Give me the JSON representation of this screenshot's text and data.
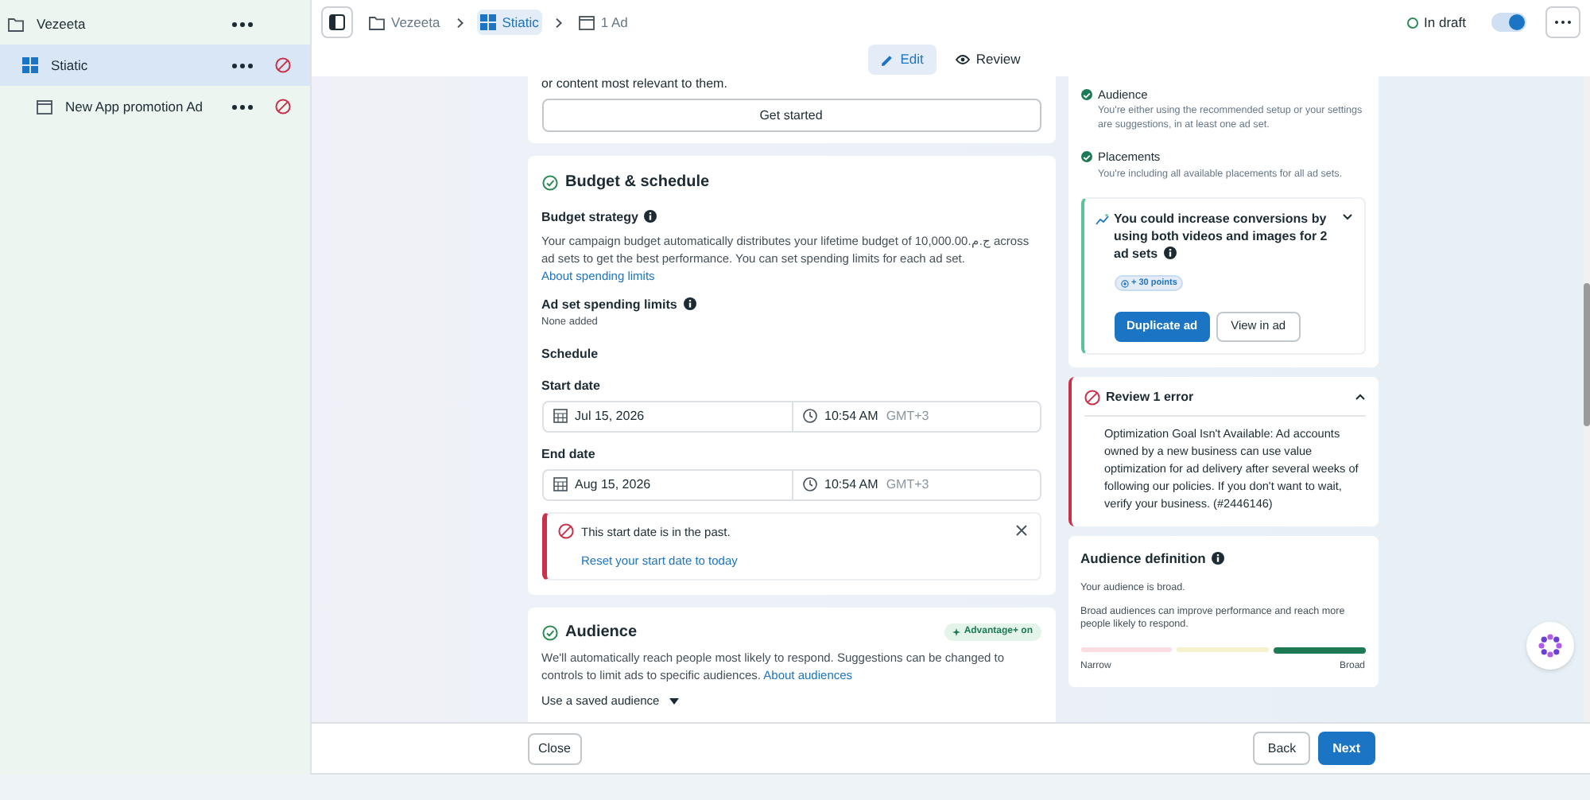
{
  "sidebar": {
    "items": [
      {
        "kind": "campaign",
        "label": "Vezeeta",
        "selected": false,
        "error": false,
        "children": [
          {
            "kind": "adset",
            "label": "Stiatic",
            "selected": true,
            "error": true,
            "children": [
              {
                "kind": "ad",
                "label": "New App promotion Ad",
                "selected": false,
                "error": true
              }
            ]
          }
        ]
      }
    ]
  },
  "breadcrumb": [
    {
      "kind": "campaign",
      "label": "Vezeeta",
      "selected": false
    },
    {
      "kind": "adset",
      "label": "Stiatic",
      "selected": true
    },
    {
      "kind": "ad",
      "label": "1 Ad",
      "selected": false
    }
  ],
  "status": {
    "label": "In draft",
    "toggle_on": true
  },
  "mode_tabs": [
    {
      "kind": "edit",
      "label": "Edit",
      "selected": true
    },
    {
      "kind": "review",
      "label": "Review",
      "selected": false
    }
  ],
  "top_card": {
    "text": "or content most relevant to them.",
    "button": "Get started"
  },
  "budget": {
    "title": "Budget & schedule",
    "strategy_label": "Budget strategy",
    "strategy_text": "Your campaign budget automatically distributes your lifetime budget of 10,000.00.ج.م across ad sets to get the best performance. You can set spending limits for each ad set.",
    "link": "About spending limits",
    "limits_label": "Ad set spending limits",
    "limits_value": "None added",
    "schedule_label": "Schedule",
    "dates": [
      {
        "label": "Start date",
        "date": "Jul 15, 2026",
        "time": "10:54 AM",
        "zone": "GMT+3"
      },
      {
        "label": "End date",
        "date": "Aug 15, 2026",
        "time": "10:54 AM",
        "zone": "GMT+3"
      }
    ],
    "alert": {
      "message": "This start date is in the past.",
      "link": "Reset your start date to today"
    }
  },
  "audience": {
    "title": "Audience",
    "badge": "Advantage+ on",
    "text": "We'll automatically reach people most likely to respond. Suggestions can be changed to controls to limit ads to specific audiences.",
    "link": "About audiences",
    "dropdown": "Use a saved audience"
  },
  "checks": [
    {
      "title": "Audience",
      "text": "You're either using the recommended setup or your settings are suggestions, in at least one ad set.",
      "done": true
    },
    {
      "title": "Placements",
      "text": "You're including all available placements for all ad sets.",
      "done": true
    }
  ],
  "recommendation": {
    "title": "You could increase conversions by using both videos and images for 2 ad sets",
    "points": "+ 30 points",
    "primary": "Duplicate ad",
    "secondary": "View in ad"
  },
  "errors": {
    "title": "Review 1 error",
    "expanded": true,
    "text": "Optimization Goal Isn't Available: Ad accounts owned by a new business can use value optimization for ad delivery after several weeks of following our policies. If you don't want to wait, verify your business. (#2446146)"
  },
  "audience_definition": {
    "title": "Audience definition",
    "summary": "Your audience is broad.",
    "text": "Broad audiences can improve performance and reach more people likely to respond.",
    "segments": [
      {
        "color": "#f9dde2",
        "selected": false
      },
      {
        "color": "#f4f1cc",
        "selected": false
      },
      {
        "color": "#1e7a55",
        "selected": true
      }
    ],
    "low_label": "Narrow",
    "high_label": "Broad"
  },
  "footer": {
    "close": "Close",
    "back": "Back",
    "next": "Next"
  }
}
